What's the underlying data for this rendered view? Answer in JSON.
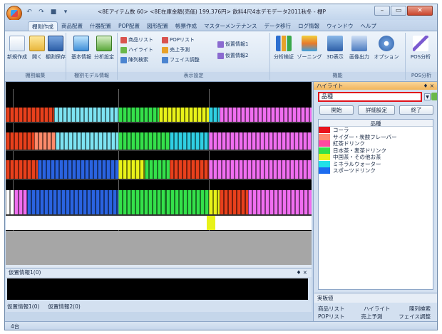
{
  "window": {
    "title": "<8Eアイテム数 60> <8E在庫金額(売価) 199,376円> 飲料4尺4本デモデータ2011秋冬 - 棚POWER",
    "buttons": {
      "minimize": "–",
      "maximize": "▭",
      "close": "✕"
    }
  },
  "qat": {
    "items": [
      "↶",
      "↷",
      "■",
      "▾"
    ]
  },
  "tabs": [
    "棚割作成",
    "商品配置",
    "什器配置",
    "POP配置",
    "図形配置",
    "帳票作成",
    "マスターメンテナンス",
    "データ移行",
    "ログ情報",
    "ウィンドウ",
    "ヘルプ"
  ],
  "ribbon": {
    "groups": [
      {
        "label": "棚割編集",
        "buttons": [
          "新規作成",
          "開く",
          "棚割保存"
        ]
      },
      {
        "label": "棚割モデル情報",
        "buttons": [
          "基本情報",
          "分析設定"
        ]
      },
      {
        "label": "表示設定",
        "buttons": [
          "商品リスト",
          "POPリスト",
          "ハイライト",
          "売上予測",
          "陳列検索",
          "フェイス調整",
          "仮置情報1",
          "仮置情報2"
        ]
      },
      {
        "label": "機能",
        "buttons": [
          "分析検証",
          "ゾーニング",
          "3D表示",
          "画像出力",
          "オプション"
        ]
      },
      {
        "label": "POS分析",
        "buttons": [
          "POS分析"
        ]
      }
    ]
  },
  "colors": {
    "shelf_palette": [
      "#e8401c",
      "#ff8a6a",
      "#7de3f2",
      "#34e04a",
      "#e8f219",
      "#2fcfe3",
      "#2a63e0",
      "#f06ef0",
      "#ffffff"
    ]
  },
  "highlight_panel": {
    "title": "ハイライト",
    "pin": "♦ ×",
    "combo_value": "品種",
    "buttons": [
      "開始",
      "詳細設定",
      "終了"
    ],
    "legend_header": "品種",
    "legend": [
      {
        "label": "コーラ",
        "color": "#e8141c"
      },
      {
        "label": "サイダー・炭酸フレーバー",
        "color": "#ff8a70"
      },
      {
        "label": "紅茶ドリンク",
        "color": "#ff4aa0"
      },
      {
        "label": "日本茶・麦茶ドリンク",
        "color": "#34e04a"
      },
      {
        "label": "中国茶・その他お茶",
        "color": "#e8f219"
      },
      {
        "label": "ミネラルウォーター",
        "color": "#22e0e8"
      },
      {
        "label": "スポーツドリンク",
        "color": "#1c6cf0"
      }
    ],
    "tab_label": "実販値",
    "nav": [
      [
        "商品リスト",
        "ハイライト",
        "陳列検索"
      ],
      [
        "POPリスト",
        "売上予測",
        "フェイス調整"
      ]
    ]
  },
  "bottom_pane": {
    "title": "仮置情報1(0)",
    "tabs": [
      "仮置情報1(0)",
      "仮置情報2(0)"
    ]
  },
  "statusbar": {
    "text": "4台"
  }
}
